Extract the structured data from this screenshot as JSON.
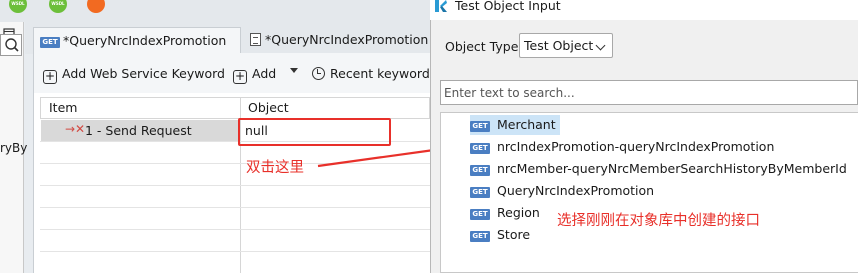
{
  "toolbar_icons": [
    {
      "name": "wsdl-icon",
      "color": "#6cbf3a",
      "label": "WSDL"
    },
    {
      "name": "wsdl-icon",
      "color": "#6cbf3a",
      "label": "WSDL"
    },
    {
      "name": "feather-icon",
      "color": "#f26a21",
      "label": ""
    }
  ],
  "sidebar": {
    "truncated_text": "ryBy"
  },
  "tabs": [
    {
      "badge": "GET",
      "label": "*QueryNrcIndexPromotion",
      "active": true
    },
    {
      "label": "*QueryNrcIndexPromotion",
      "active": false
    }
  ],
  "editor_toolbar": {
    "add_keyword_label": "Add Web Service Keyword",
    "add_label": "Add",
    "recent_label": "Recent keywords"
  },
  "table": {
    "headers": [
      "Item",
      "Object"
    ],
    "rows": [
      {
        "arrow": "→✕",
        "item": "1 - Send Request",
        "object": "null"
      }
    ]
  },
  "annotations": {
    "double_click": "双击这里",
    "select_interface": "选择刚刚在对象库中创建的接口"
  },
  "dialog": {
    "title": "Test Object Input",
    "object_type_label": "Object Type",
    "object_type_value": "Test Object",
    "search_placeholder": "Enter text to search...",
    "badge": "GET",
    "items": [
      {
        "label": "Merchant",
        "selected": true
      },
      {
        "label": "nrcIndexPromotion-queryNrcIndexPromotion"
      },
      {
        "label": "nrcMember-queryNrcMemberSearchHistoryByMemberId"
      },
      {
        "label": "QueryNrcIndexPromotion"
      },
      {
        "label": "Region"
      },
      {
        "label": "Store"
      }
    ]
  },
  "colors": {
    "accent_red": "#e8302a",
    "get_badge": "#4a7ec2",
    "selection": "#cce4f7"
  }
}
